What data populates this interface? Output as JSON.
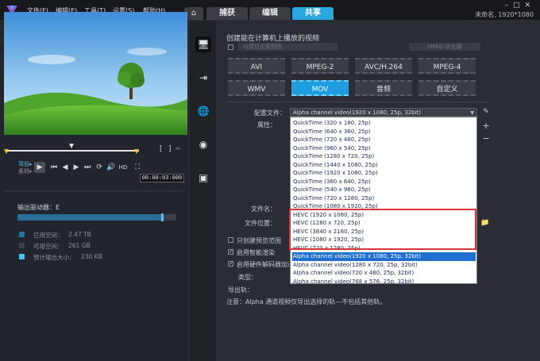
{
  "menu": {
    "file": "文件(F)",
    "edit": "编辑(E)",
    "tools": "工具(T)",
    "settings": "设置(S)",
    "help": "帮助(H)"
  },
  "tabs": {
    "capture": "捕获",
    "edit": "编辑",
    "share": "共享"
  },
  "project_info": "未命名, 1920*1080",
  "player": {
    "project_label": "项目▸",
    "clip_label": "素材▸",
    "hd_label": "HD",
    "timecode": "00:00:03:000"
  },
  "drive": {
    "label": "输出驱动器：E",
    "used_fraction": 0.92,
    "legend": [
      {
        "label": "已用空间：",
        "value": "2.47 TB",
        "color": "#2b6e97"
      },
      {
        "label": "可用空间：",
        "value": "261 GB",
        "color": "#3c4048"
      },
      {
        "label": "预计输出大小：",
        "value": "230 KB",
        "color": "#53c0f5"
      }
    ]
  },
  "share": {
    "heading": "创建能在计算机上播放的视频",
    "match_setting_placeholder": "与项目设置相同",
    "mpeg_optimizer_placeholder": "MPEG 优化器",
    "formats_row1": [
      "AVI",
      "MPEG-2",
      "AVC/H.264",
      "MPEG-4"
    ],
    "formats_row2": [
      "WMV",
      "MOV",
      "音频",
      "自定义"
    ],
    "selected_format": "MOV",
    "profile_label": "配置文件：",
    "properties_label": "属性：",
    "filename_label": "文件名：",
    "location_label": "文件位置：",
    "type_label": "类型：",
    "export_track_label": "导出轨：",
    "profile_value": "Alpha channel video(1920 x 1080, 25p, 32bit)",
    "options": [
      "QuickTime (320 x 180, 25p)",
      "QuickTime (640 x 360, 25p)",
      "QuickTime (720 x 480, 25p)",
      "QuickTime (960 x 540, 25p)",
      "QuickTime (1280 x 720, 25p)",
      "QuickTime (1440 x 1080, 25p)",
      "QuickTime (1920 x 1080, 25p)",
      "QuickTime (360 x 640, 25p)",
      "QuickTime (540 x 960, 25p)",
      "QuickTime (720 x 1280, 25p)",
      "QuickTime (1080 x 1920, 25p)",
      "HEVC (1920 x 1080, 25p)",
      "HEVC (1280 x 720, 25p)",
      "HEVC (3840 x 2160, 25p)",
      "HEVC (1080 x 1920, 25p)",
      "HEVC (720 x 1280, 25p)",
      "Alpha channel video(1920 x 1080, 25p, 32bit)",
      "Alpha channel video(1280 x 720, 25p, 32bit)",
      "Alpha channel video(720 x 480, 25p, 32bit)",
      "Alpha channel video(768 x 576, 25p, 32bit)"
    ],
    "checkboxes": [
      {
        "label": "只创建预览范围",
        "checked": false
      },
      {
        "label": "启用智能渲染",
        "checked": true
      },
      {
        "label": "启用硬件解码器加速",
        "checked": true
      }
    ],
    "note": "注意：Alpha 通道视频仅导出选择的轨—不包括其他轨。"
  },
  "colors": {
    "accent": "#1e9de0",
    "highlight": "#1f6fd1",
    "red_box": "#d9343a"
  }
}
